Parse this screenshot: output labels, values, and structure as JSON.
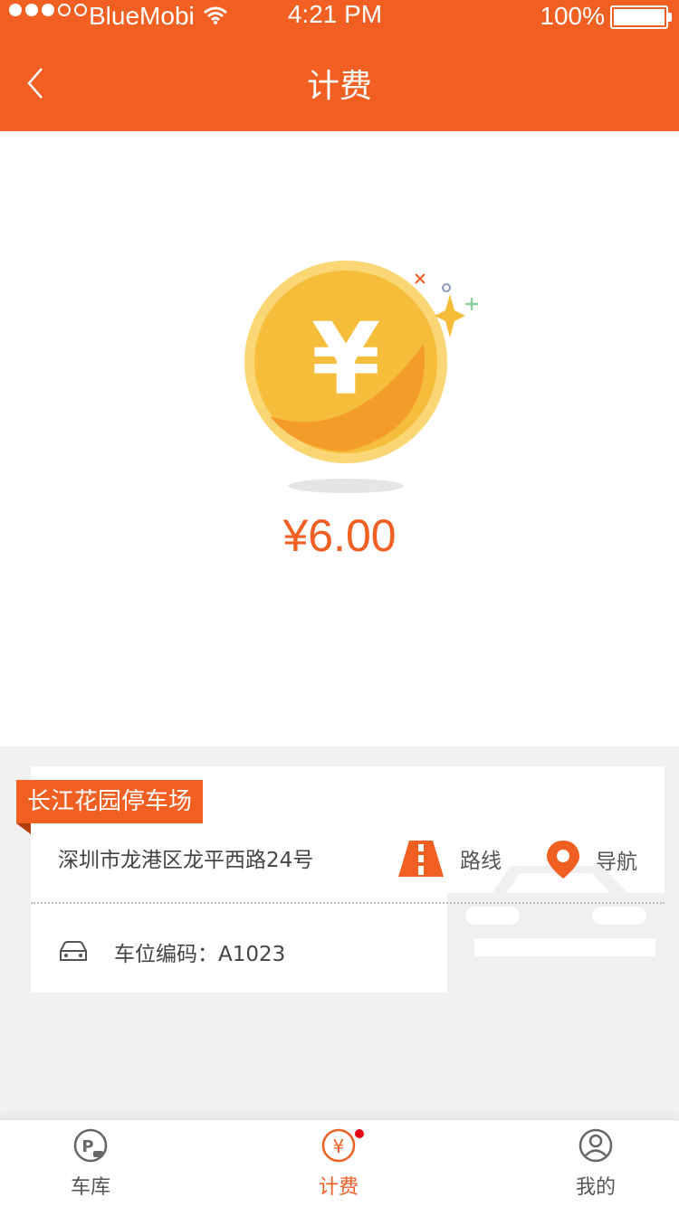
{
  "status_bar": {
    "carrier": "BlueMobi",
    "time": "4:21 PM",
    "battery": "100%"
  },
  "nav": {
    "title": "计费"
  },
  "billing": {
    "amount": "¥6.00",
    "coin_symbol": "¥"
  },
  "parking": {
    "name": "长江花园停车场",
    "address": "深圳市龙港区龙平西路24号",
    "route_label": "路线",
    "navigate_label": "导航",
    "slot_text": "车位编码：A1023"
  },
  "tabbar": {
    "items": [
      {
        "label": "车库",
        "icon": "garage-icon"
      },
      {
        "label": "计费",
        "icon": "yen-icon",
        "active": true
      },
      {
        "label": "我的",
        "icon": "user-icon"
      }
    ]
  },
  "colors": {
    "accent": "#f15f23",
    "coin": "#f6bd3a",
    "badge": "#e60012"
  }
}
